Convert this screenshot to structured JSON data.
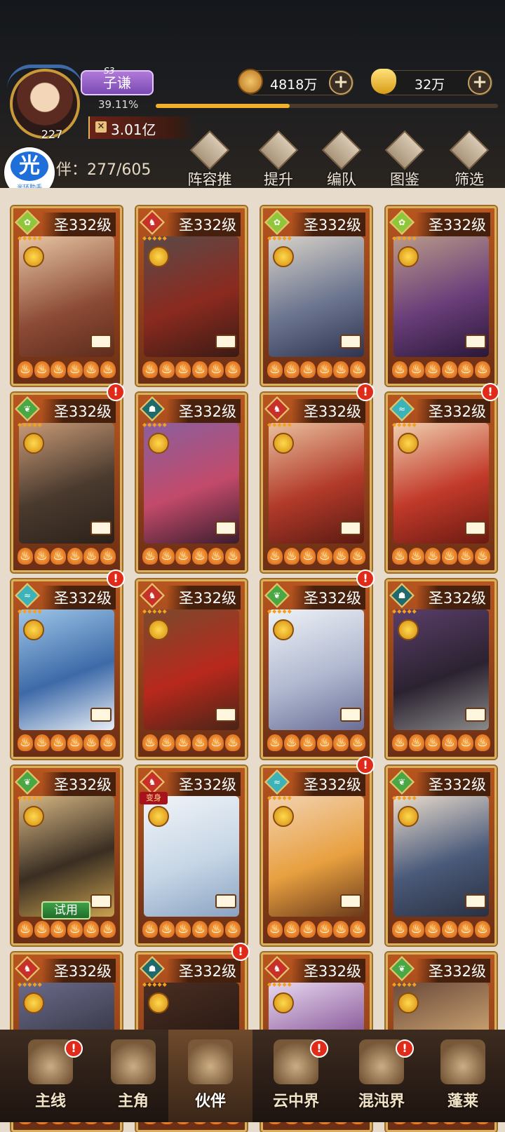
{
  "player": {
    "season": "S3",
    "name": "子谦",
    "level": "227",
    "exp_percent": "39.11%",
    "exp_fraction": 0.3911,
    "power": "3.01亿"
  },
  "resources": {
    "coins": "4818万",
    "gold": "32万"
  },
  "watermark": {
    "glyph": "光",
    "text": "光环助手"
  },
  "partner_count": "伴：277/605",
  "toolbar": [
    {
      "label": "阵容推荐",
      "icon": "lineup-icon"
    },
    {
      "label": "提升",
      "icon": "upgrade-icon"
    },
    {
      "label": "编队",
      "icon": "formation-icon"
    },
    {
      "label": "图鉴",
      "icon": "codex-icon"
    },
    {
      "label": "筛选",
      "icon": "filter-icon"
    }
  ],
  "cards": [
    {
      "level": "圣332级",
      "element": "wood",
      "alert": false
    },
    {
      "level": "圣332级",
      "element": "fire",
      "alert": false
    },
    {
      "level": "圣332级",
      "element": "wood",
      "alert": false
    },
    {
      "level": "圣332级",
      "element": "wood",
      "alert": false
    },
    {
      "level": "圣332级",
      "element": "wind",
      "alert": true
    },
    {
      "level": "圣332级",
      "element": "ghost",
      "alert": false
    },
    {
      "level": "圣332级",
      "element": "fire",
      "alert": true
    },
    {
      "level": "圣332级",
      "element": "water",
      "alert": true
    },
    {
      "level": "圣332级",
      "element": "water",
      "alert": true
    },
    {
      "level": "圣332级",
      "element": "fire",
      "alert": false
    },
    {
      "level": "圣332级",
      "element": "wind",
      "alert": true
    },
    {
      "level": "圣332级",
      "element": "ghost",
      "alert": false
    },
    {
      "level": "圣332级",
      "element": "wind",
      "alert": false,
      "trial": "试用"
    },
    {
      "level": "圣332级",
      "element": "fire",
      "alert": false,
      "badge": "变身"
    },
    {
      "level": "圣332级",
      "element": "water",
      "alert": true
    },
    {
      "level": "圣332级",
      "element": "wind",
      "alert": false
    },
    {
      "level": "圣332级",
      "element": "fire",
      "alert": false
    },
    {
      "level": "圣332级",
      "element": "ghost",
      "alert": true
    },
    {
      "level": "圣332级",
      "element": "fire",
      "alert": false
    },
    {
      "level": "圣332级",
      "element": "wind",
      "alert": false
    }
  ],
  "nav": [
    {
      "label": "主线",
      "alert": true,
      "active": false
    },
    {
      "label": "主角",
      "alert": false,
      "active": false
    },
    {
      "label": "伙伴",
      "alert": false,
      "active": true
    },
    {
      "label": "云中界",
      "alert": true,
      "active": false
    },
    {
      "label": "混沌界",
      "alert": true,
      "active": false
    },
    {
      "label": "蓬莱",
      "alert": false,
      "active": false
    }
  ],
  "colors": {
    "accent": "#f1b02b",
    "alert": "#e02a1a",
    "card_border": "#d9b05c",
    "name_plate": "#9a63c9"
  }
}
